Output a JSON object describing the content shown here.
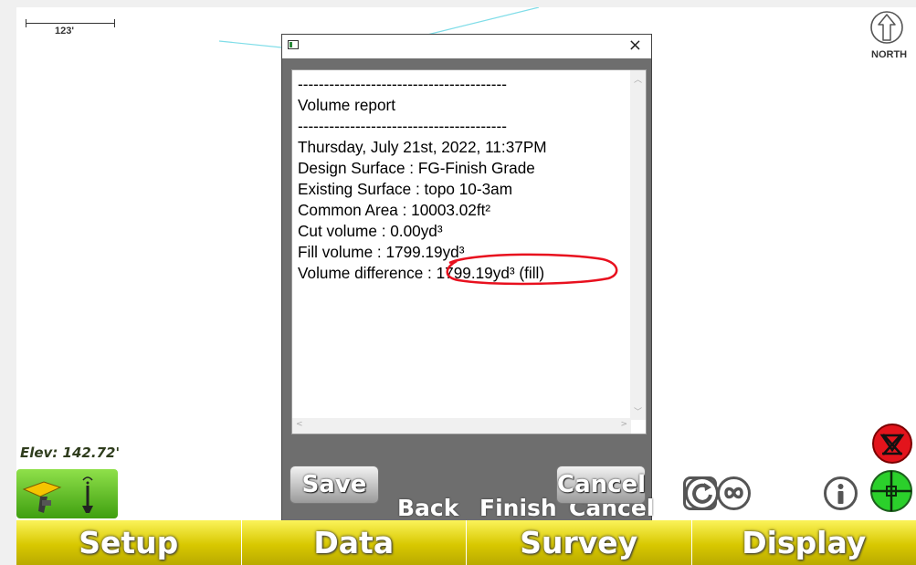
{
  "map": {
    "scale_label": "123'",
    "north_label": "NORTH",
    "elevation": "Elev: 142.72'"
  },
  "dialog": {
    "report_lines": [
      "----------------------------------------",
      "Volume report",
      "----------------------------------------",
      "Thursday, July 21st, 2022, 11:37PM",
      "Design Surface : FG-Finish Grade",
      "Existing Surface : topo 10-3am",
      "Common Area : 10003.02ft²",
      "Cut volume : 0.00yd³",
      "Fill volume : 1799.19yd³",
      "Volume difference : 1799.19yd³ (fill)"
    ],
    "save_label": "Save",
    "cancel_label": "Cancel",
    "hidden_back_label": "Back",
    "hidden_finish_label": "Finish",
    "hidden_cancel_label": "Cancel",
    "close_glyph": "×",
    "highlight_color": "#e8101e"
  },
  "toolbar": {
    "items": [
      "Setup",
      "Data",
      "Survey",
      "Display"
    ]
  },
  "icons": [
    "scale-bar",
    "north-arrow-icon",
    "gps-rover-icon",
    "refresh-icon",
    "infinity-icon",
    "info-icon",
    "crosshair-icon",
    "remove-point-icon"
  ],
  "colors": {
    "toolbar": "#d8c800",
    "gps_button": "#6fc62a",
    "map_line": "#7fdde8"
  }
}
